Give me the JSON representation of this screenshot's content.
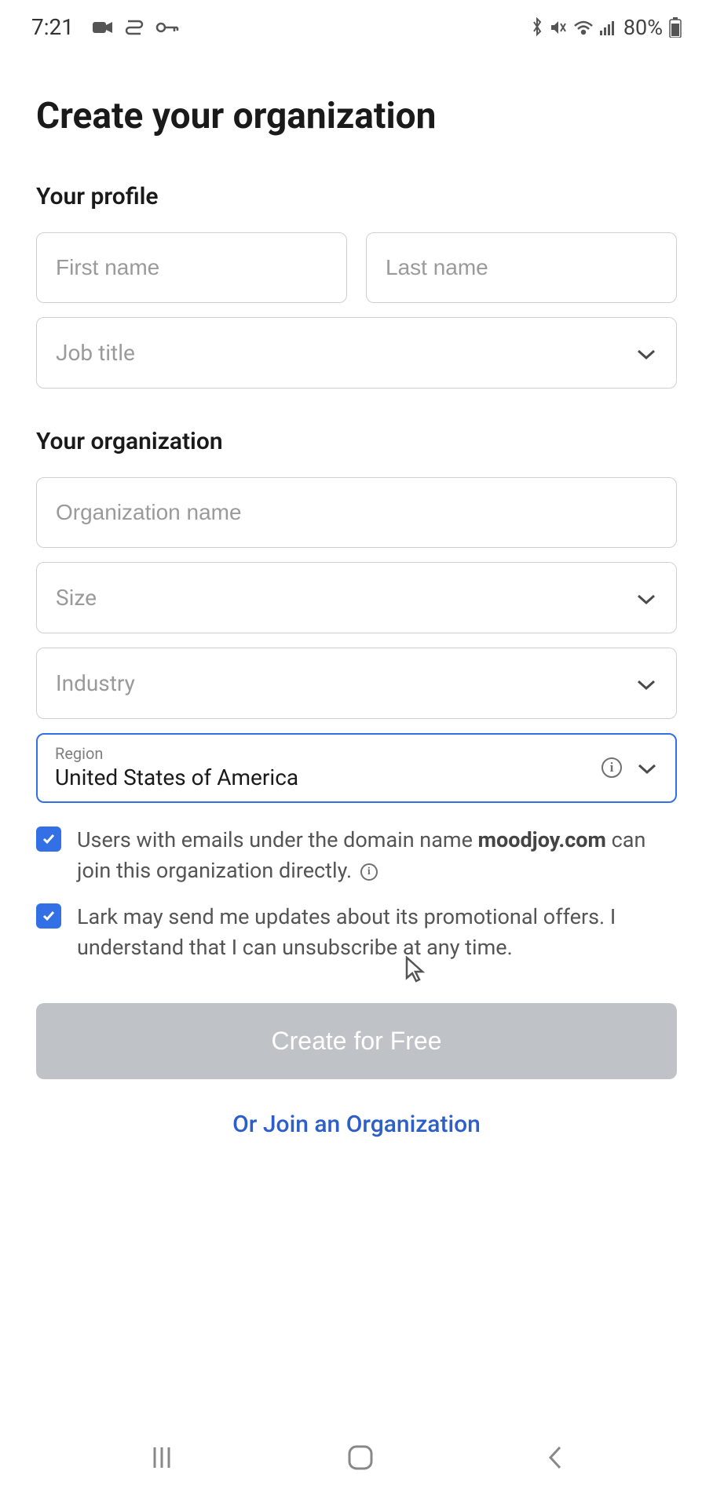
{
  "status": {
    "time": "7:21",
    "battery": "80%"
  },
  "page": {
    "title": "Create your organization"
  },
  "profile": {
    "section_title": "Your profile",
    "first_name_placeholder": "First name",
    "last_name_placeholder": "Last name",
    "job_title_placeholder": "Job title"
  },
  "organization": {
    "section_title": "Your organization",
    "org_name_placeholder": "Organization name",
    "size_placeholder": "Size",
    "industry_placeholder": "Industry",
    "region_label": "Region",
    "region_value": "United States of America"
  },
  "checkboxes": {
    "domain_text_before": "Users with emails under the domain name ",
    "domain_name": "moodjoy.com",
    "domain_text_after": " can join this organization directly.",
    "promo_text": "Lark may send me updates about its promotional offers. I understand that I can unsubscribe at any time."
  },
  "actions": {
    "create_label": "Create for Free",
    "join_label": "Or Join an Organization"
  }
}
